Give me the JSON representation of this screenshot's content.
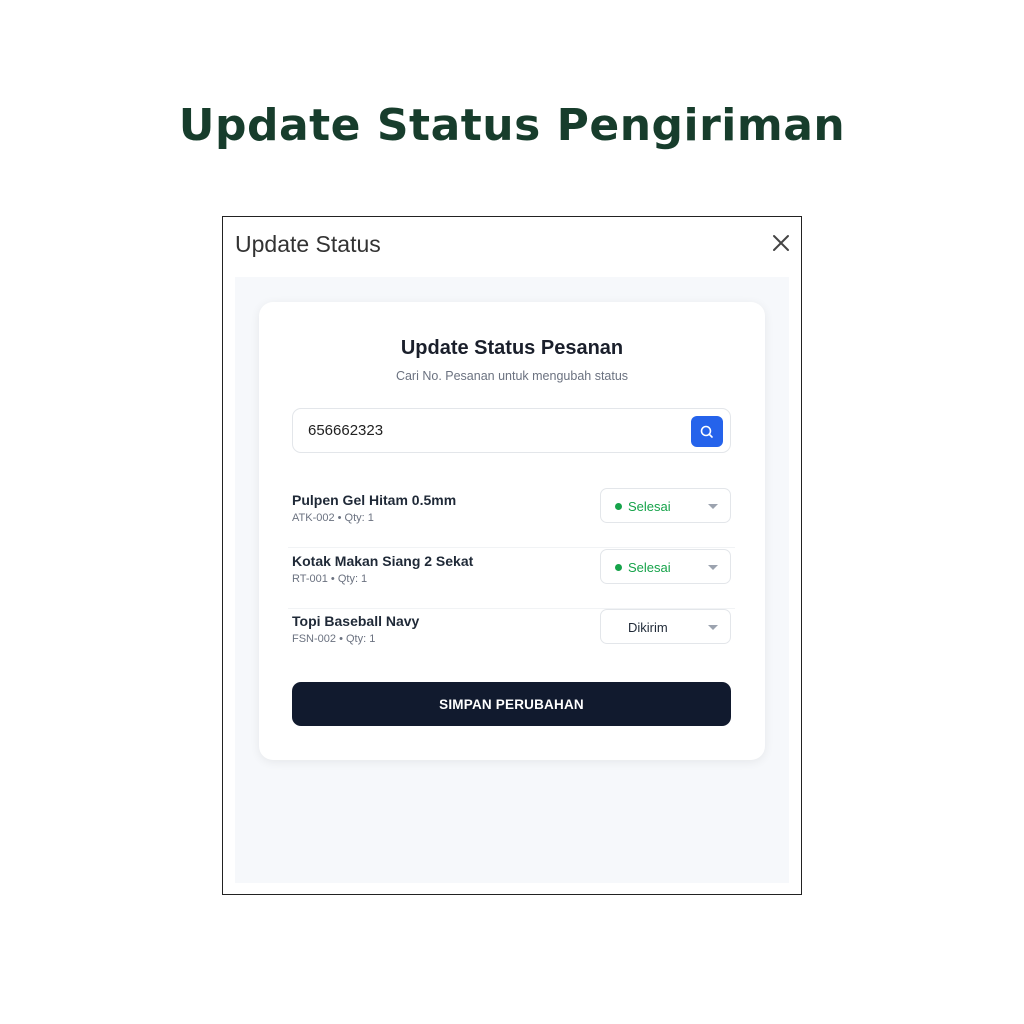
{
  "page": {
    "title": "Update Status Pengiriman"
  },
  "dialog": {
    "title": "Update Status",
    "close_icon": "close-icon"
  },
  "card": {
    "title": "Update Status Pesanan",
    "subtitle": "Cari No. Pesanan untuk mengubah status"
  },
  "search": {
    "value": "656662323",
    "placeholder": "",
    "button_icon": "search-icon"
  },
  "items": [
    {
      "name": "Pulpen Gel Hitam 0.5mm",
      "meta": "ATK-002 • Qty: 1",
      "status": "Selesai"
    },
    {
      "name": "Kotak Makan Siang 2 Sekat",
      "meta": "RT-001 • Qty: 1",
      "status": "Selesai"
    },
    {
      "name": "Topi Baseball Navy",
      "meta": "FSN-002 • Qty: 1",
      "status": "Dikirim"
    }
  ],
  "save_button": {
    "label": "SIMPAN PERUBAHAN"
  },
  "colors": {
    "page_title": "#173d2c",
    "search_button": "#2563eb",
    "status_done": "#16a34a",
    "save_button": "#111a2e"
  }
}
